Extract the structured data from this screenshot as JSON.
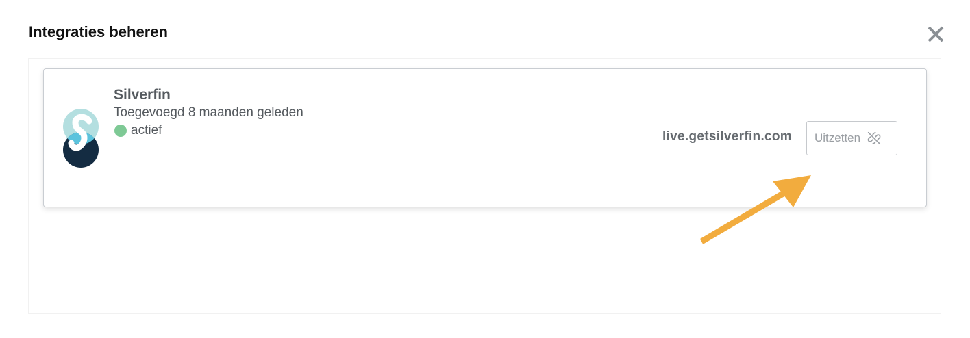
{
  "modal": {
    "title": "Integraties beheren"
  },
  "integration": {
    "name": "Silverfin",
    "added": "Toegevoegd 8 maanden geleden",
    "status": "actief",
    "url": "live.getsilverfin.com",
    "disable_label": "Uitzetten"
  },
  "icons": {
    "close": "close-icon",
    "unlink": "unlink-icon",
    "logo": "silverfin-logo",
    "annotation": "arrow-annotation"
  },
  "colors": {
    "status_active": "#7ec995",
    "logo_light": "#b4dfe0",
    "logo_mid": "#5bc3dd",
    "logo_dark": "#142c42",
    "annotation_arrow": "#f2ac3e"
  }
}
